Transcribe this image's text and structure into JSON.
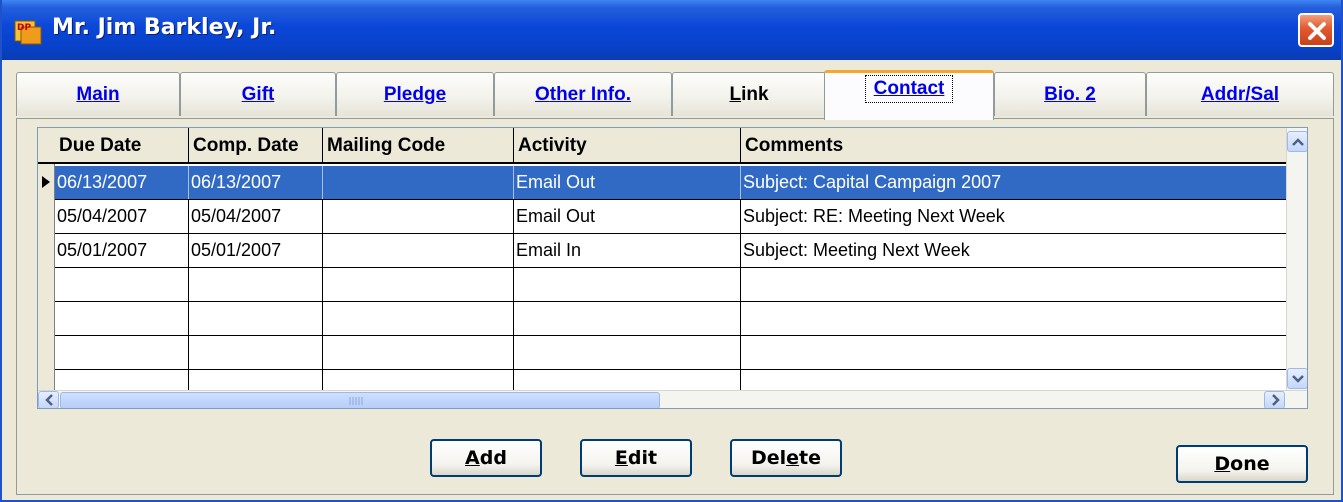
{
  "window": {
    "title": "Mr. Jim Barkley, Jr.",
    "title_color": "#ffffff",
    "titlebar_color": "#0a46d8",
    "close_color": "#e2592e"
  },
  "tabs": [
    {
      "key": "M",
      "rest": "ain"
    },
    {
      "key": "G",
      "rest": "ift"
    },
    {
      "key": "P",
      "rest": "ledge"
    },
    {
      "key": "O",
      "rest": "ther Info."
    },
    {
      "key": "L",
      "rest": "ink"
    },
    {
      "key": "C",
      "rest": "ontact"
    },
    {
      "key": "B",
      "rest": "io. 2"
    },
    {
      "key": "A",
      "rest": "ddr/Sal"
    }
  ],
  "active_tab": "Contact",
  "grid": {
    "columns": [
      "Due Date",
      "Comp. Date",
      "Mailing Code",
      "Activity",
      "Comments"
    ],
    "rows": [
      {
        "due": "06/13/2007",
        "comp": "06/13/2007",
        "mailing": "",
        "activity": "Email Out",
        "comments": "Subject: Capital Campaign 2007"
      },
      {
        "due": "05/04/2007",
        "comp": "05/04/2007",
        "mailing": "",
        "activity": "Email Out",
        "comments": "Subject: RE: Meeting Next Week"
      },
      {
        "due": "05/01/2007",
        "comp": "05/01/2007",
        "mailing": "",
        "activity": "Email In",
        "comments": "Subject: Meeting Next Week"
      }
    ],
    "selection_color": "#316ac5"
  },
  "buttons": {
    "add": {
      "pre": "",
      "key": "A",
      "post": "dd"
    },
    "edit": {
      "pre": "",
      "key": "E",
      "post": "dit"
    },
    "delete": {
      "pre": "Del",
      "key": "e",
      "post": "te"
    },
    "done": {
      "pre": "",
      "key": "D",
      "post": "one"
    }
  }
}
